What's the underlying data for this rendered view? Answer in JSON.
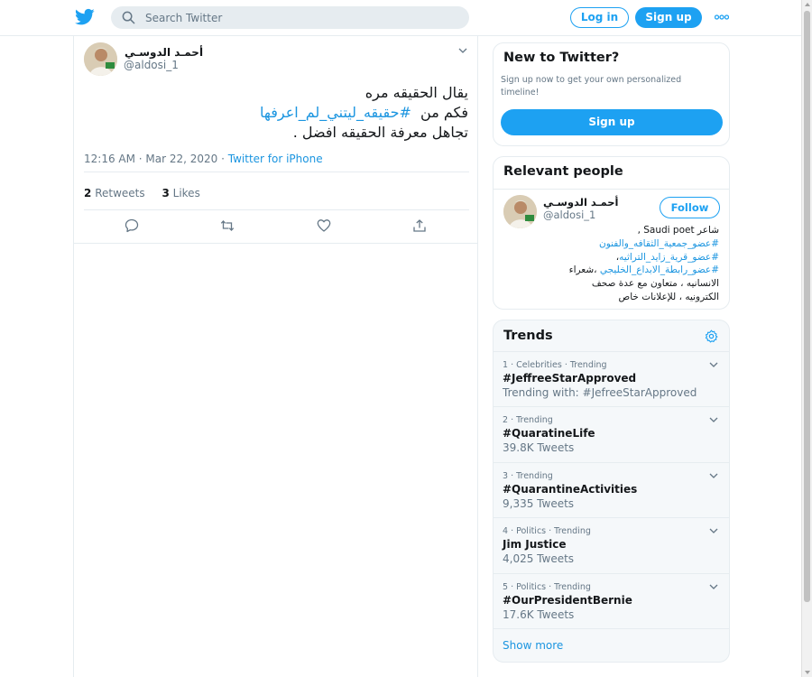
{
  "header": {
    "search_placeholder": "Search Twitter",
    "login_label": "Log in",
    "signup_label": "Sign up"
  },
  "tweet": {
    "author_name": "أحمـد الدوسـي",
    "author_handle": "@aldosi_1",
    "line1": "يقال الحقيقه مره",
    "line2_prefix": "فكم من",
    "line2_hashtag": "#حقيقه_ليتني_لم_اعرفها",
    "line3": "تجاهل معرفة الحقيقه افضل .",
    "time": "12:16 AM · Mar 22, 2020 · ",
    "source": "Twitter for iPhone",
    "retweets_count": "2",
    "retweets_label": "Retweets",
    "likes_count": "3",
    "likes_label": "Likes"
  },
  "new_to_twitter": {
    "title": "New to Twitter?",
    "description": "Sign up now to get your own personalized timeline!",
    "signup_label": "Sign up"
  },
  "relevant_people": {
    "title": "Relevant people",
    "name": "أحمـد الدوسـي",
    "handle": "@aldosi_1",
    "follow_label": "Follow",
    "bio_line1": "شاعر Saudi poet ,",
    "bio_tag1": "#عضو_جمعية_الثقافه_والفنون",
    "bio_tag2": "#عضو_قرية_زايد_التراثيه",
    "bio_tag2_suffix": "،",
    "bio_tag3": "#عضو_رابطة_الابداع_الخليجي",
    "bio_line4_suffix": "،شعراء",
    "bio_line5": "الانسانيه ، متعاون مع عدة صحف",
    "bio_line6": "الكترونيه ، للإعلانات خاص"
  },
  "trends": {
    "title": "Trends",
    "items": [
      {
        "context": "1 · Celebrities · Trending",
        "name": "#JeffreeStarApproved",
        "count": "Trending with: #JefreeStarApproved"
      },
      {
        "context": "2 · Trending",
        "name": "#QuaratineLife",
        "count": "39.8K Tweets"
      },
      {
        "context": "3 · Trending",
        "name": "#QuarantineActivities",
        "count": "9,335 Tweets"
      },
      {
        "context": "4 · Politics · Trending",
        "name": "Jim Justice",
        "count": "4,025 Tweets"
      },
      {
        "context": "5 · Politics · Trending",
        "name": "#OurPresidentBernie",
        "count": "17.6K Tweets"
      }
    ],
    "show_more": "Show more"
  },
  "colors": {
    "accent": "#1da1f2",
    "link": "#1b95e0",
    "secondary_text": "#657786",
    "border": "#e6ecf0",
    "trends_bg": "#f5f8fa"
  }
}
